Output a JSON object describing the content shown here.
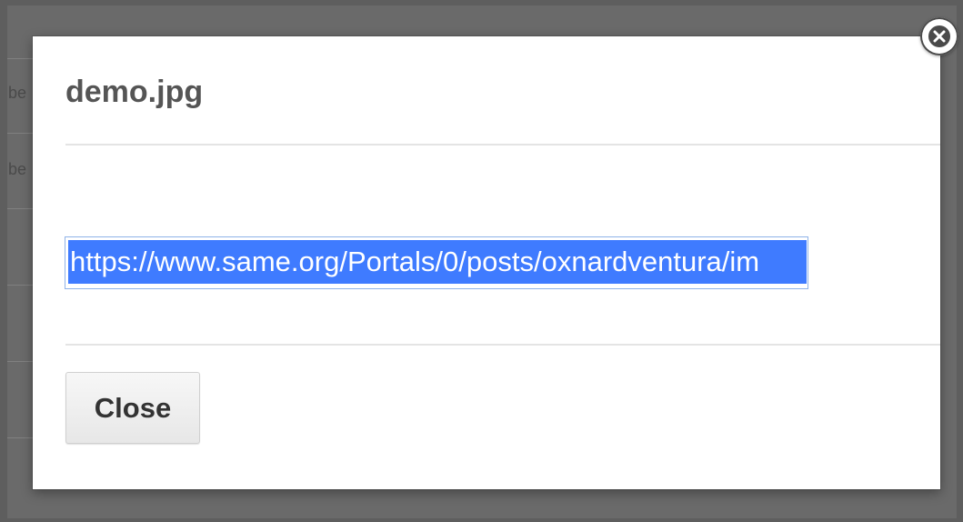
{
  "background": {
    "snippets": [
      "be",
      "be"
    ]
  },
  "dialog": {
    "title": "demo.jpg",
    "url_value": "https://www.same.org/Portals/0/posts/oxnardventura/im",
    "close_label": "Close",
    "close_icon": "close-circle-icon"
  },
  "colors": {
    "selection": "#3f7bff",
    "title": "#555555"
  }
}
